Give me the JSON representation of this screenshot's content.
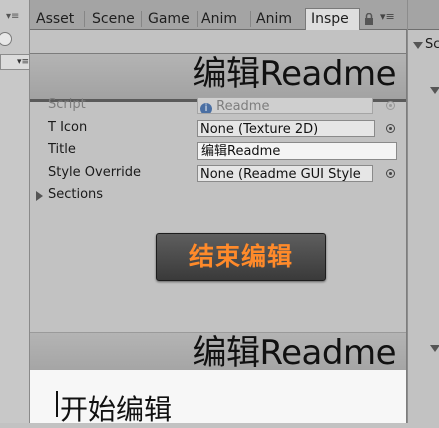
{
  "left_pane": {
    "menu_icon": "menu-dropdown-icon",
    "dropdown_label": "▾≡"
  },
  "tabs": [
    {
      "label": "Asset",
      "active": false
    },
    {
      "label": "Scene",
      "active": false
    },
    {
      "label": "Game",
      "active": false
    },
    {
      "label": "Anim",
      "active": false
    },
    {
      "label": "Anim",
      "active": false
    },
    {
      "label": "Inspe",
      "active": true
    }
  ],
  "tab_icons": {
    "lock": "lock-icon",
    "menu": "menu-icon",
    "menu_glyph": "▾≡"
  },
  "inspector": {
    "banner_title": "编辑Readme",
    "fields": {
      "script": {
        "label": "Script",
        "value": "Readme",
        "icon": "info-icon"
      },
      "icon": {
        "label": "T Icon",
        "value": "None (Texture 2D)"
      },
      "title": {
        "label": "Title",
        "value": "编辑Readme"
      },
      "style": {
        "label": "Style Override",
        "value": "None (Readme GUI Style"
      }
    },
    "sections": {
      "label": "Sections"
    },
    "end_edit_button": "结束编辑",
    "preview_banner_title": "编辑Readme",
    "content_title": "开始编辑"
  },
  "right_pane": {
    "label": "Sc"
  },
  "colors": {
    "button_text": "#ff8a2a",
    "button_bg": "#454545",
    "panel": "#c2c2c2",
    "banner": "#aaaaaa"
  }
}
